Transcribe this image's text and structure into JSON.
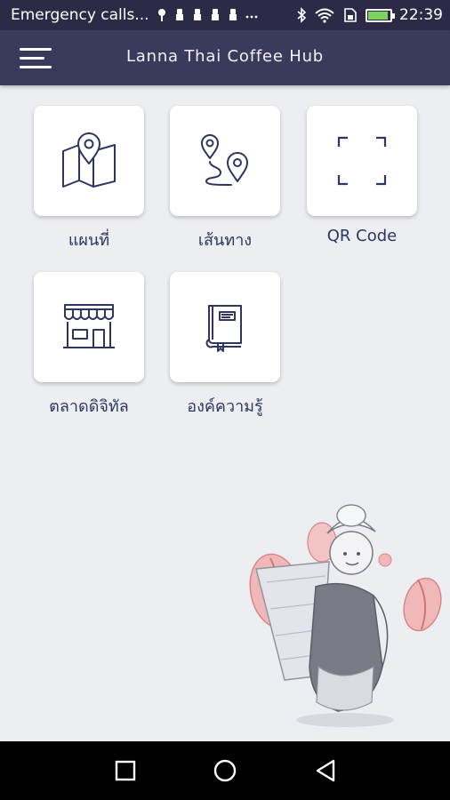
{
  "status_bar": {
    "carrier_text": "Emergency calls...",
    "time": "22:39",
    "icons": [
      "wifi-signal-icon",
      "notification-icon",
      "notification-icon",
      "notification-icon",
      "notification-icon",
      "more-icon",
      "bluetooth-icon",
      "wifi-icon",
      "sim-icon",
      "battery-icon"
    ]
  },
  "app_bar": {
    "title": "Lanna Thai Coffee Hub",
    "menu_icon": "hamburger-menu-icon"
  },
  "tiles": [
    {
      "label": "แผนที่",
      "icon": "map-icon"
    },
    {
      "label": "เส้นทาง",
      "icon": "route-icon"
    },
    {
      "label": "QR Code",
      "icon": "qr-scan-icon"
    },
    {
      "label": "ตลาดดิจิทัล",
      "icon": "shop-icon"
    },
    {
      "label": "องค์ความรู้",
      "icon": "book-icon"
    }
  ],
  "colors": {
    "app_bar": "#3a3a5c",
    "status_bar": "#2b2b47",
    "background": "#eceef2",
    "icon_stroke": "#2e3560",
    "accent_red": "#e98c8c"
  },
  "nav_bar": {
    "icons": [
      "recent-apps-icon",
      "home-icon",
      "back-icon"
    ]
  }
}
